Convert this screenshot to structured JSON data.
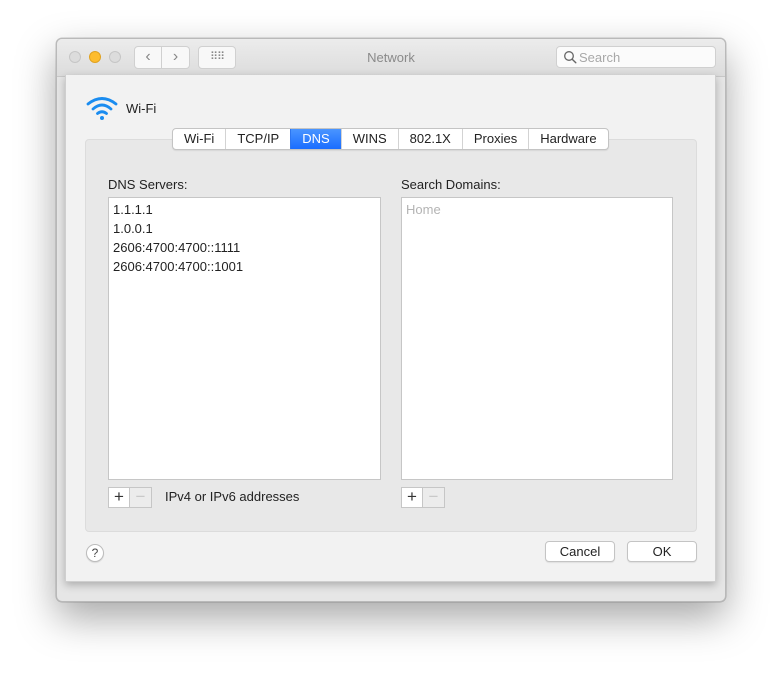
{
  "window": {
    "title": "Network",
    "nav": {
      "back_icon": "‹",
      "forward_icon": "›",
      "grid_icon": "⠿⠿"
    },
    "search": {
      "placeholder": "Search",
      "value": ""
    }
  },
  "sheet": {
    "service_name": "Wi-Fi",
    "tabs": [
      {
        "label": "Wi-Fi",
        "active": false
      },
      {
        "label": "TCP/IP",
        "active": false
      },
      {
        "label": "DNS",
        "active": true
      },
      {
        "label": "WINS",
        "active": false
      },
      {
        "label": "802.1X",
        "active": false
      },
      {
        "label": "Proxies",
        "active": false
      },
      {
        "label": "Hardware",
        "active": false
      }
    ],
    "dns_servers": {
      "label": "DNS Servers:",
      "items": [
        "1.1.1.1",
        "1.0.0.1",
        "2606:4700:4700::1111",
        "2606:4700:4700::1001"
      ],
      "hint": "IPv4 or IPv6 addresses"
    },
    "search_domains": {
      "label": "Search Domains:",
      "placeholder": "Home",
      "items": []
    },
    "add_symbol": "+",
    "remove_symbol": "−",
    "help_symbol": "?",
    "cancel_label": "Cancel",
    "ok_label": "OK"
  },
  "colors": {
    "accent": "#1a6dff",
    "minimize_light": "#fdbc2e"
  }
}
